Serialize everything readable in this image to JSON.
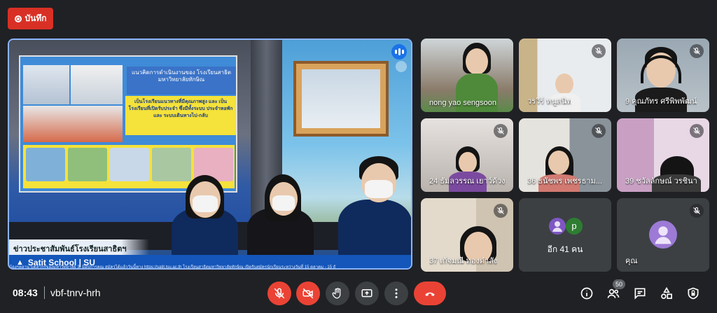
{
  "record": {
    "label": "บันทึก"
  },
  "main_video": {
    "caption": "ข่าวประชาสัมพันธ์โรงเรียนสาธิตฯ",
    "ticker_school": "Satit School | SU",
    "ticker_text": "น้องๆหลาน บุคลากรของมหาวิทยาลัย 3. มีอุปการคุณ สมัครได้แล้ววันนี้ทาง https://satit.tsu.ac.th โรงเรียนสาธิตมหาวิทยาลัยทักษิณ เปิดรับสมัครนักเรียนระหว่างวันที่ 15 ตุลาคม - 15 ธั",
    "slide_title": "แนวคิดการดำเนินงานของ โรงเรียนสาธิตมหาวิทยาลัยทักษิณ",
    "slide_body": "เป็นโรงเรียนแนวทางที่มีคุณภาพสูง และ เป็นโรงเรียนที่เปิดรับประจำ ซึ่งมีทั้งระบบ ประจำหอพัก และ ระบบเดินทางไป-กลับ"
  },
  "participants": [
    {
      "name": "nong yao sengsoon",
      "muted": false,
      "bg": "#8a7b6a"
    },
    {
      "name": "วรวีร์ หนูสนิท",
      "muted": true,
      "bg": "#c9b48a"
    },
    {
      "name": "9 คุณภัทร ศรีพิพพัฒน์",
      "muted": true,
      "bg": "#9aa8b3"
    },
    {
      "name": "24 ธัมลวรรณ เยาว์ด้วง",
      "muted": true,
      "bg": "#b9b2ad"
    },
    {
      "name": "36 ธนัชพร เพชรธาม...",
      "muted": true,
      "bg": "#b0aba4"
    },
    {
      "name": "39 ชวัลลักษณ์ วรชินา",
      "muted": true,
      "bg": "#b8a4b8"
    },
    {
      "name": "37 เก้จมณี ทองดำสัง",
      "muted": true,
      "bg": "#cfc3b1"
    }
  ],
  "others": {
    "label": "อีก 41 คน",
    "avatar_letter": "p"
  },
  "self": {
    "name": "คุณ"
  },
  "bottom": {
    "time": "08:43",
    "meeting_code": "vbf-tnrv-hrh",
    "people_count": "50"
  },
  "colors": {
    "accent": "#8ab4f8",
    "danger": "#ea4335",
    "tile": "#3c4043",
    "bg": "#202124"
  }
}
